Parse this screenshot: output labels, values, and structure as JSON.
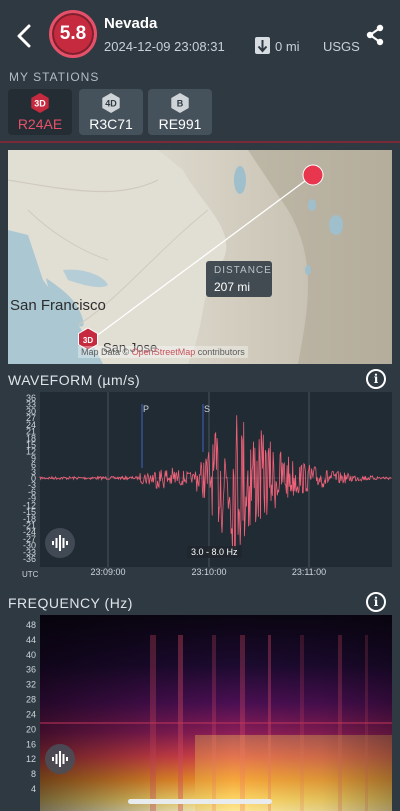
{
  "header": {
    "magnitude": "5.8",
    "event_name": "Nevada",
    "event_time": "2024-12-09 23:08:31",
    "distance": "0 mi",
    "source": "USGS",
    "icons": {
      "back": "back-chevron-icon",
      "share": "share-icon",
      "distance": "arrow-down-icon"
    }
  },
  "stations": {
    "title": "MY STATIONS",
    "items": [
      {
        "badge": "3D",
        "label": "R24AE",
        "active": true,
        "badge_color": "#c62a3e"
      },
      {
        "badge": "4D",
        "label": "R3C71",
        "active": false,
        "badge_color": "#cfd4d8"
      },
      {
        "badge": "B",
        "label": "RE991",
        "active": false,
        "badge_color": "#cfd4d8"
      }
    ]
  },
  "map": {
    "distance_label": "DISTANCE",
    "distance_value": "207 mi",
    "city_1": "San Francisco",
    "city_2": "San Jose",
    "station_badge": "3D",
    "attribution_pre": "Map Data ©",
    "attribution_link": "OpenStreetMap",
    "attribution_post": "contributors"
  },
  "waveform": {
    "title": "WAVEFORM (µm/s)",
    "filter_label": "3.0 - 8.0 Hz",
    "utc_label": "UTC",
    "y_ticks": [
      "36",
      "33",
      "30",
      "27",
      "24",
      "21",
      "18",
      "15",
      "12",
      "9",
      "6",
      "3",
      "0",
      "-3",
      "-6",
      "-9",
      "-12",
      "-15",
      "-18",
      "-21",
      "-24",
      "-27",
      "-30",
      "-33",
      "-36"
    ],
    "x_ticks": [
      "23:09:00",
      "23:10:00",
      "23:11:00"
    ],
    "phase_labels": [
      "P",
      "S"
    ],
    "colors": {
      "trace": "#f0627a",
      "phase": "#3f63c6"
    }
  },
  "frequency": {
    "title": "FREQUENCY (Hz)",
    "y_ticks": [
      "48",
      "44",
      "40",
      "36",
      "32",
      "28",
      "24",
      "20",
      "16",
      "12",
      "8",
      "4"
    ]
  },
  "colors": {
    "accent": "#e6516a",
    "background": "#2e3942",
    "magnitude": "#c62a3e"
  }
}
